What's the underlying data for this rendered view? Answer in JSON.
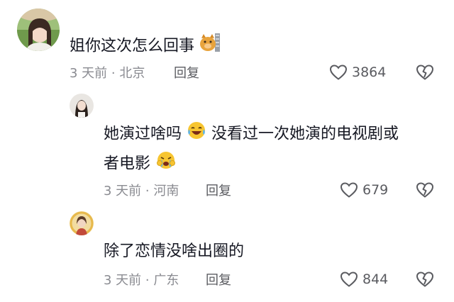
{
  "comments": [
    {
      "text": "姐你这次怎么回事",
      "meta": "3 天前 · 北京",
      "reply_label": "回复",
      "likes": "3864"
    },
    {
      "text_line1a": "她演过啥吗",
      "text_line1b": "没看过一次她演的电视剧或",
      "text_line2": "者电影",
      "meta": "3 天前 · 河南",
      "reply_label": "回复",
      "likes": "679"
    },
    {
      "text": "除了恋情没啥出圈的",
      "meta": "3 天前 · 广东",
      "reply_label": "回复",
      "likes": "844"
    }
  ]
}
